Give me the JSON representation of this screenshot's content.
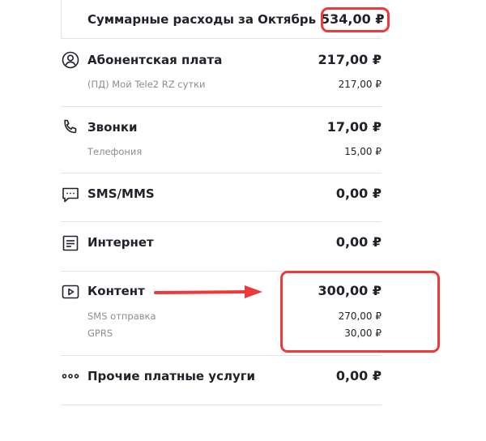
{
  "summary": {
    "title": "Суммарные расходы за Октябрь",
    "total": "534,00 ₽"
  },
  "categories": [
    {
      "title": "Абонентская плата",
      "amount": "217,00 ₽",
      "icon": "person-icon",
      "items": [
        {
          "name": "(ПД) Мой Tele2 RZ сутки",
          "amount": "217,00 ₽"
        }
      ]
    },
    {
      "title": "Звонки",
      "amount": "17,00 ₽",
      "icon": "phone-icon",
      "items": [
        {
          "name": "Телефония",
          "amount": "15,00 ₽"
        }
      ]
    },
    {
      "title": "SMS/MMS",
      "amount": "0,00 ₽",
      "icon": "message-icon",
      "items": []
    },
    {
      "title": "Интернет",
      "amount": "0,00 ₽",
      "icon": "document-icon",
      "items": []
    },
    {
      "title": "Контент",
      "amount": "300,00 ₽",
      "icon": "play-icon",
      "items": [
        {
          "name": "SMS отправка",
          "amount": "270,00 ₽"
        },
        {
          "name": "GPRS",
          "amount": "30,00 ₽"
        }
      ]
    },
    {
      "title": "Прочие платные услуги",
      "amount": "0,00 ₽",
      "icon": "more-dots-icon",
      "items": []
    }
  ],
  "colors": {
    "annotation": "#ea3a3a",
    "text": "#1f2229",
    "muted": "#8a8d93",
    "divider": "#e3e3e3"
  }
}
